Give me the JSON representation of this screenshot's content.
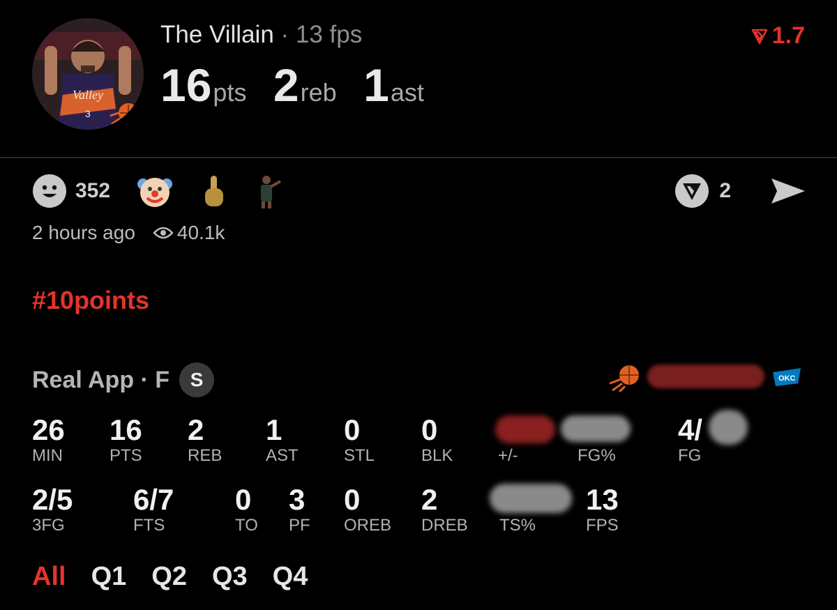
{
  "header": {
    "name": "The Villain",
    "separator": "·",
    "fps_label": "13 fps",
    "stats": [
      {
        "value": "16",
        "unit": "pts"
      },
      {
        "value": "2",
        "unit": "reb"
      },
      {
        "value": "1",
        "unit": "ast"
      }
    ],
    "rating": "1.7",
    "avatar_jersey_text": "Valley",
    "avatar_jersey_number": "3"
  },
  "reactions": {
    "reaction_count": "352",
    "emojis": [
      "clown-emoji",
      "middle-finger-emoji",
      "player-sticker"
    ],
    "vote_count": "2"
  },
  "meta": {
    "time_ago": "2 hours ago",
    "views": "40.1k"
  },
  "hashtag": "#10points",
  "source": {
    "label": "Real App · F",
    "badge": "S"
  },
  "stats_row1": [
    {
      "value": "26",
      "label": "MIN"
    },
    {
      "value": "16",
      "label": "PTS"
    },
    {
      "value": "2",
      "label": "REB"
    },
    {
      "value": "1",
      "label": "AST"
    },
    {
      "value": "0",
      "label": "STL"
    },
    {
      "value": "0",
      "label": "BLK"
    },
    {
      "value": "",
      "label": "+/-"
    },
    {
      "value": "",
      "label": "FG%"
    },
    {
      "value": "4/",
      "label": "FG"
    }
  ],
  "stats_row2": [
    {
      "value": "2/5",
      "label": "3FG"
    },
    {
      "value": "6/7",
      "label": "FTS"
    },
    {
      "value": "0",
      "label": "TO"
    },
    {
      "value": "3",
      "label": "PF"
    },
    {
      "value": "0",
      "label": "OREB"
    },
    {
      "value": "2",
      "label": "DREB"
    },
    {
      "value": "",
      "label": "TS%"
    },
    {
      "value": "13",
      "label": "FPS"
    }
  ],
  "tabs": [
    "All",
    "Q1",
    "Q2",
    "Q3",
    "Q4"
  ],
  "colors": {
    "accent_red": "#e3342c",
    "background": "#000000",
    "suns_orange": "#e56020",
    "okc_blue": "#007ac1"
  }
}
